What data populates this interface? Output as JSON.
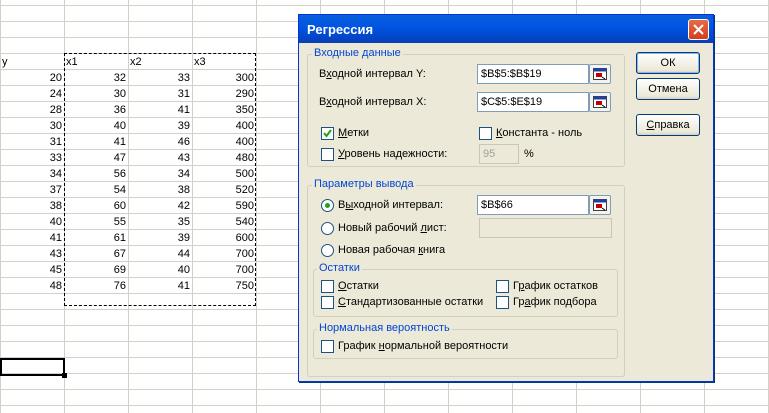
{
  "sheet": {
    "headers": [
      "y",
      "x1",
      "x2",
      "x3"
    ],
    "rows": [
      [
        "20",
        "32",
        "33",
        "300"
      ],
      [
        "24",
        "30",
        "31",
        "290"
      ],
      [
        "28",
        "36",
        "41",
        "350"
      ],
      [
        "30",
        "40",
        "39",
        "400"
      ],
      [
        "31",
        "41",
        "46",
        "400"
      ],
      [
        "33",
        "47",
        "43",
        "480"
      ],
      [
        "34",
        "56",
        "34",
        "500"
      ],
      [
        "37",
        "54",
        "38",
        "520"
      ],
      [
        "38",
        "60",
        "42",
        "590"
      ],
      [
        "40",
        "55",
        "35",
        "540"
      ],
      [
        "41",
        "61",
        "39",
        "600"
      ],
      [
        "43",
        "67",
        "44",
        "700"
      ],
      [
        "45",
        "69",
        "40",
        "700"
      ],
      [
        "48",
        "76",
        "41",
        "750"
      ]
    ]
  },
  "dialog": {
    "title": "Регрессия",
    "input_group": {
      "title": "Входные данные",
      "y_label_pre": "В",
      "y_label_u": "х",
      "y_label_post": "одной интервал Y:",
      "y_value": "$B$5:$B$19",
      "x_label_pre": "В",
      "x_label_u": "х",
      "x_label_post": "одной интервал X:",
      "x_value": "$C$5:$E$19",
      "labels_u": "М",
      "labels_post": "етки",
      "labels_checked": true,
      "constant_u": "К",
      "constant_post": "онстанта - ноль",
      "constant_checked": false,
      "confidence_u": "У",
      "confidence_post": "ровень надежности:",
      "confidence_checked": false,
      "confidence_value": "95",
      "percent": "%"
    },
    "output_group": {
      "title": "Параметры вывода",
      "range_pre": "В",
      "range_u": "ы",
      "range_post": "ходной интервал:",
      "range_value": "$B$66",
      "range_selected": true,
      "new_sheet_pre": "Новый рабочий ",
      "new_sheet_u": "л",
      "new_sheet_post": "ист:",
      "new_sheet_value": "",
      "new_book_pre": "Новая рабочая ",
      "new_book_u": "к",
      "new_book_post": "нига"
    },
    "residuals_group": {
      "title": "Остатки",
      "residuals_u": "О",
      "residuals_post": "статки",
      "std_residuals_u": "С",
      "std_residuals_post": "тандартизованные остатки",
      "residual_plot_pre": "Г",
      "residual_plot_u": "р",
      "residual_plot_post": "афик остатков",
      "fit_plot_pre": "Гр",
      "fit_plot_u": "а",
      "fit_plot_post": "фик подбора"
    },
    "normal_group": {
      "title": "Нормальная вероятность",
      "plot_pre": "График ",
      "plot_u": "н",
      "plot_post": "ормальной вероятности"
    },
    "buttons": {
      "ok": "ОК",
      "cancel": "Отмена",
      "help_u": "С",
      "help_post": "правка"
    },
    "colors": {
      "title_bar": "#0054e3",
      "group_label": "#0046d5",
      "dialog_bg": "#ece9d8",
      "close_button": "#d2401d"
    },
    "icons": [
      "close-icon",
      "range-select-icon",
      "checkmark-icon"
    ]
  }
}
